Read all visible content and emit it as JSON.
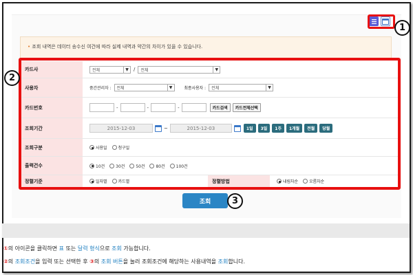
{
  "view_toggle": {
    "list_icon": "list-icon",
    "calendar_icon": "calendar-icon"
  },
  "callouts": {
    "c1": "1",
    "c2": "2",
    "c3": "3"
  },
  "notice": {
    "bullet": "•",
    "text": "조회 내역은 데이터 송수신 여건에 따라 실제 내역과 약간의 차이가 있을 수 있습니다."
  },
  "form": {
    "card_company": {
      "label": "카드사",
      "select1": "전체",
      "sep": "/",
      "select2": "전체"
    },
    "user": {
      "label": "사용자",
      "mid_label": "중간관리자 :",
      "mid_value": "전체",
      "end_label": "최종사용자 :",
      "end_value": "전체"
    },
    "card_number": {
      "label": "카드번호",
      "dash": "-",
      "search_btn": "카드검색",
      "select_all_btn": "카드전체선택"
    },
    "period": {
      "label": "조회기간",
      "start_date": "2015-12-03",
      "tilde": "~",
      "end_date": "2015-12-03",
      "quick": [
        "1일",
        "3일",
        "1주",
        "1개월",
        "전월",
        "당월"
      ]
    },
    "query_type": {
      "label": "조회구분",
      "options": [
        {
          "label": "사용일",
          "checked": true
        },
        {
          "label": "청구일",
          "checked": false
        }
      ]
    },
    "output_count": {
      "label": "출력건수",
      "options": [
        {
          "label": "10건",
          "checked": true
        },
        {
          "label": "30건",
          "checked": false
        },
        {
          "label": "50건",
          "checked": false
        },
        {
          "label": "80건",
          "checked": false
        },
        {
          "label": "100건",
          "checked": false
        }
      ]
    },
    "sort_basis": {
      "label": "정렬기준",
      "options": [
        {
          "label": "일자별",
          "checked": true
        },
        {
          "label": "카드별",
          "checked": false
        }
      ]
    },
    "sort_method": {
      "label": "정렬방법",
      "options": [
        {
          "label": "내림차순",
          "checked": true
        },
        {
          "label": "오름차순",
          "checked": false
        }
      ]
    }
  },
  "search_button": {
    "label": "조회"
  },
  "notes": {
    "line1": {
      "num": "①",
      "p1": "의 아이콘을 클릭하면 ",
      "h1": "표",
      "p2": " 또는 ",
      "h2": "달력 형식",
      "p3": "으로 ",
      "h3": "조회",
      "p4": " 가능합니다."
    },
    "line2": {
      "num": "②",
      "p1": "의 ",
      "h1": "조회조건",
      "p2": "을 입력 또는 선택한 후 ",
      "num2": "③",
      "p3": "의 ",
      "h2": "조회 버튼",
      "p4": "을 눌러 조회조건에 해당하는 사용내역을 ",
      "h3": "조회",
      "p5": "합니다."
    }
  },
  "colors": {
    "highlight_red": "#e81010",
    "link_blue": "#1e7fc0",
    "search_button": "#2b86c5",
    "quick_button": "#2b6c7d"
  }
}
